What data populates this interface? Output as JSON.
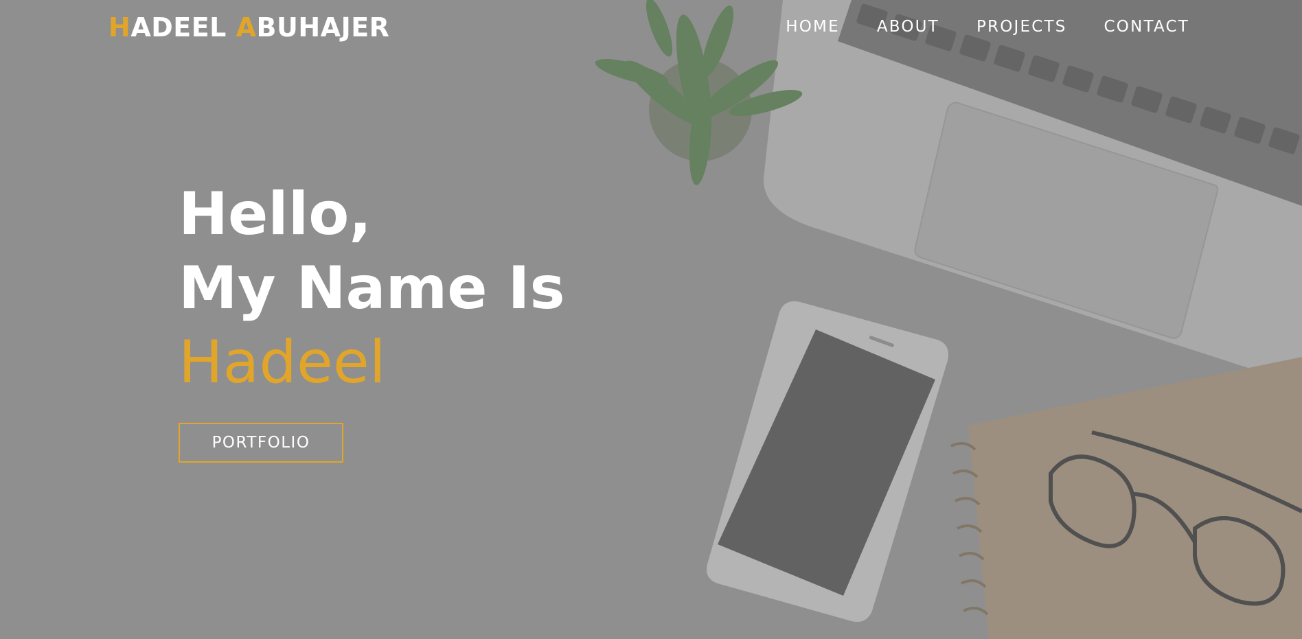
{
  "brand": {
    "first_initial": "H",
    "first_rest": "ADEEL ",
    "last_initial": "A",
    "last_rest": "BUHAJER"
  },
  "nav": {
    "items": [
      "HOME",
      "ABOUT",
      "PROJECTS",
      "CONTACT"
    ]
  },
  "hero": {
    "line1": "Hello,",
    "line2": "My Name Is",
    "name": "Hadeel",
    "button_label": "PORTFOLIO"
  },
  "colors": {
    "accent": "#e1a52a",
    "overlay": "#8f8f8f",
    "text": "#ffffff"
  },
  "background": {
    "icons": [
      "cactus-plant-icon",
      "laptop-icon",
      "smartphone-icon",
      "notebook-icon",
      "glasses-icon"
    ]
  }
}
